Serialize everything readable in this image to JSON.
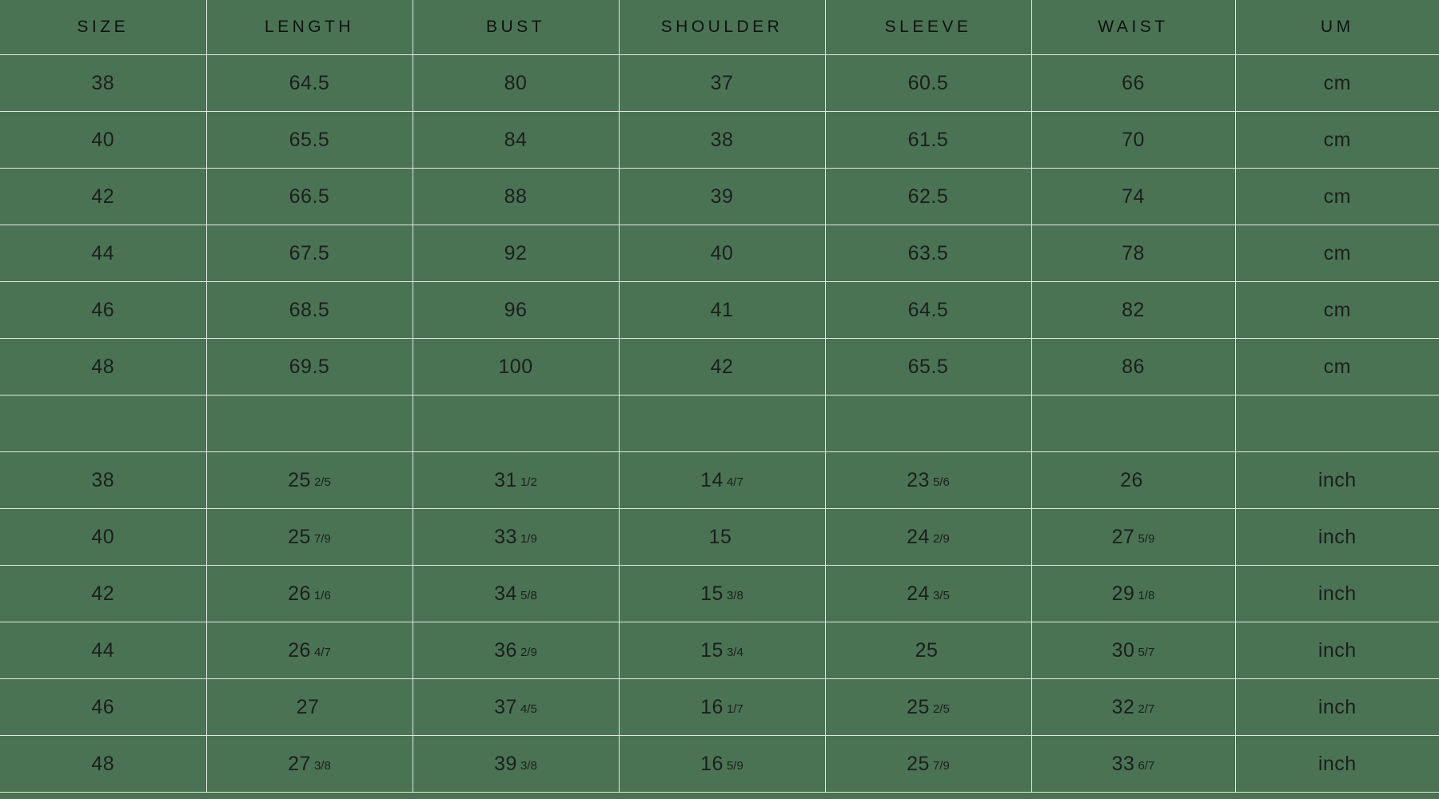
{
  "table": {
    "headers": [
      "SIZE",
      "LENGTH",
      "BUST",
      "SHOULDER",
      "SLEEVE",
      "WAIST",
      "UM"
    ],
    "colors": {
      "background": "#4a7354",
      "gridline": "#dfe7e1",
      "text": "#1c1c1c"
    },
    "metric_rows": [
      {
        "size": "38",
        "length": "64.5",
        "bust": "80",
        "shoulder": "37",
        "sleeve": "60.5",
        "waist": "66",
        "um": "cm"
      },
      {
        "size": "40",
        "length": "65.5",
        "bust": "84",
        "shoulder": "38",
        "sleeve": "61.5",
        "waist": "70",
        "um": "cm"
      },
      {
        "size": "42",
        "length": "66.5",
        "bust": "88",
        "shoulder": "39",
        "sleeve": "62.5",
        "waist": "74",
        "um": "cm"
      },
      {
        "size": "44",
        "length": "67.5",
        "bust": "92",
        "shoulder": "40",
        "sleeve": "63.5",
        "waist": "78",
        "um": "cm"
      },
      {
        "size": "46",
        "length": "68.5",
        "bust": "96",
        "shoulder": "41",
        "sleeve": "64.5",
        "waist": "82",
        "um": "cm"
      },
      {
        "size": "48",
        "length": "69.5",
        "bust": "100",
        "shoulder": "42",
        "sleeve": "65.5",
        "waist": "86",
        "um": "cm"
      }
    ],
    "imperial_rows": [
      {
        "size": "38",
        "length_whole": "25",
        "length_frac": "2/5",
        "bust_whole": "31",
        "bust_frac": "1/2",
        "shoulder_whole": "14",
        "shoulder_frac": "4/7",
        "sleeve_whole": "23",
        "sleeve_frac": "5/6",
        "waist_whole": "26",
        "waist_frac": "",
        "um": "inch"
      },
      {
        "size": "40",
        "length_whole": "25",
        "length_frac": "7/9",
        "bust_whole": "33",
        "bust_frac": "1/9",
        "shoulder_whole": "15",
        "shoulder_frac": "",
        "sleeve_whole": "24",
        "sleeve_frac": "2/9",
        "waist_whole": "27",
        "waist_frac": "5/9",
        "um": "inch"
      },
      {
        "size": "42",
        "length_whole": "26",
        "length_frac": "1/6",
        "bust_whole": "34",
        "bust_frac": "5/8",
        "shoulder_whole": "15",
        "shoulder_frac": "3/8",
        "sleeve_whole": "24",
        "sleeve_frac": "3/5",
        "waist_whole": "29",
        "waist_frac": "1/8",
        "um": "inch"
      },
      {
        "size": "44",
        "length_whole": "26",
        "length_frac": "4/7",
        "bust_whole": "36",
        "bust_frac": "2/9",
        "shoulder_whole": "15",
        "shoulder_frac": "3/4",
        "sleeve_whole": "25",
        "sleeve_frac": "",
        "waist_whole": "30",
        "waist_frac": "5/7",
        "um": "inch"
      },
      {
        "size": "46",
        "length_whole": "27",
        "length_frac": "",
        "bust_whole": "37",
        "bust_frac": "4/5",
        "shoulder_whole": "16",
        "shoulder_frac": "1/7",
        "sleeve_whole": "25",
        "sleeve_frac": "2/5",
        "waist_whole": "32",
        "waist_frac": "2/7",
        "um": "inch"
      },
      {
        "size": "48",
        "length_whole": "27",
        "length_frac": "3/8",
        "bust_whole": "39",
        "bust_frac": "3/8",
        "shoulder_whole": "16",
        "shoulder_frac": "5/9",
        "sleeve_whole": "25",
        "sleeve_frac": "7/9",
        "waist_whole": "33",
        "waist_frac": "6/7",
        "um": "inch"
      }
    ]
  }
}
